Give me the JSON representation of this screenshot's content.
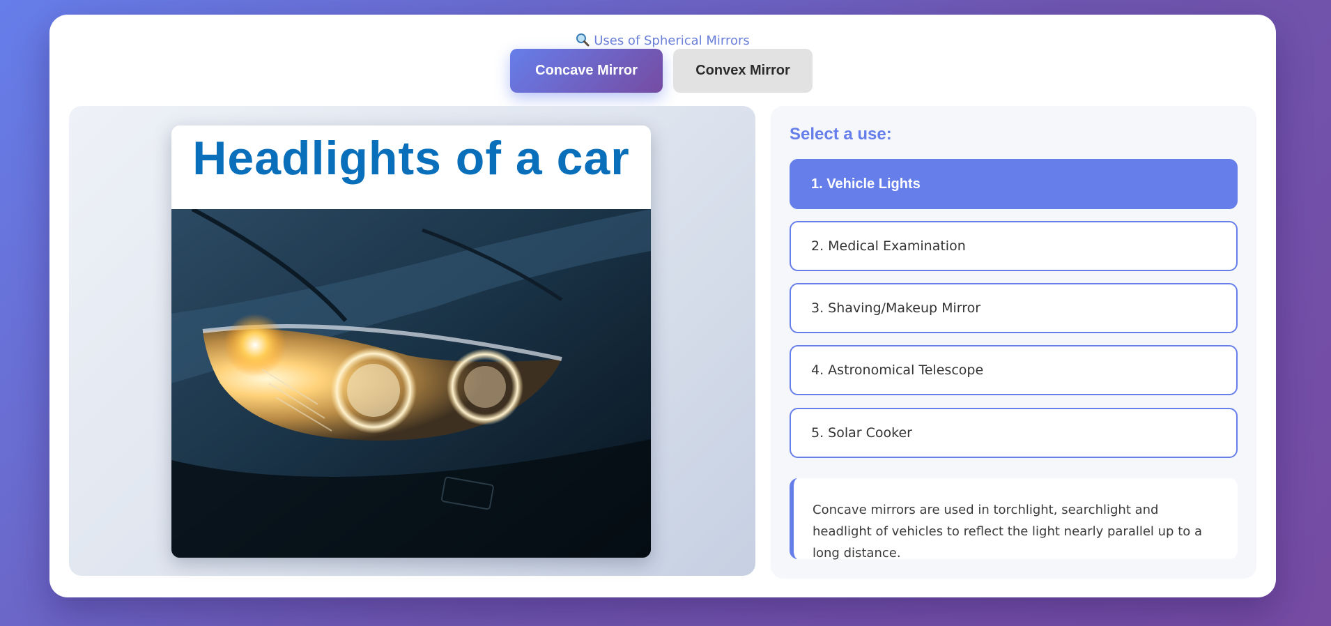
{
  "app": {
    "title": "Uses of Spherical Mirrors",
    "title_icon": "magnifier-icon"
  },
  "tabs": [
    {
      "label": "Concave Mirror",
      "active": true
    },
    {
      "label": "Convex Mirror",
      "active": false
    }
  ],
  "image_panel": {
    "caption": "Headlights of a car",
    "photo_subject": "car-headlight-photo"
  },
  "uses": {
    "heading": "Select a use:",
    "items": [
      {
        "label": "1. Vehicle Lights",
        "selected": true
      },
      {
        "label": "2. Medical Examination",
        "selected": false
      },
      {
        "label": "3. Shaving/Makeup Mirror",
        "selected": false
      },
      {
        "label": "4. Astronomical Telescope",
        "selected": false
      },
      {
        "label": "5. Solar Cooker",
        "selected": false
      }
    ],
    "description": "Concave mirrors are used in torchlight, searchlight and headlight of vehicles to reflect the light nearly parallel up to a long distance."
  },
  "colors": {
    "accent": "#667eea",
    "gradient_end": "#764ba2",
    "caption_blue": "#0a6fba"
  }
}
